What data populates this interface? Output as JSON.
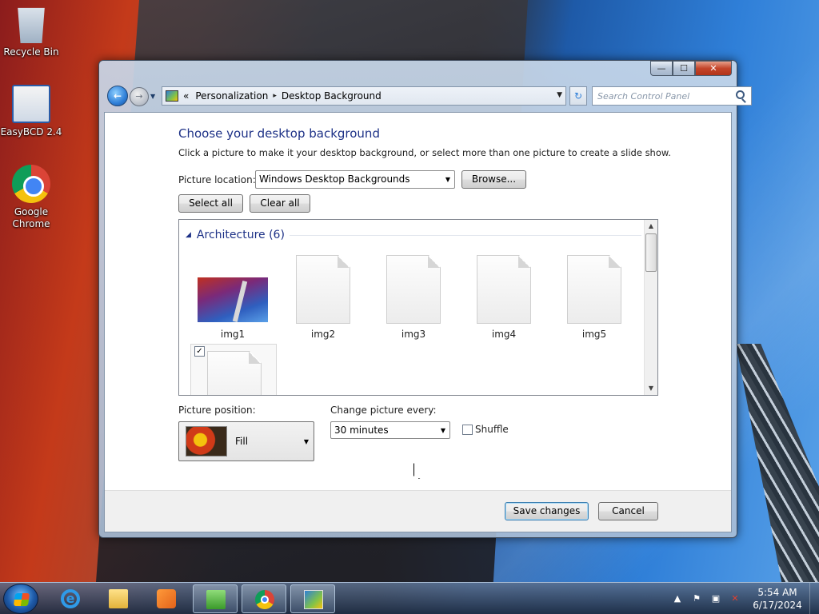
{
  "desktop": {
    "icons": [
      {
        "label": "Recycle Bin"
      },
      {
        "label": "EasyBCD 2.4"
      },
      {
        "label": "Google Chrome"
      }
    ]
  },
  "window": {
    "caption": {
      "minimize": "—",
      "maximize": "☐",
      "close": "✕"
    },
    "nav": {
      "back": "←",
      "forward": "→",
      "history": "▼"
    },
    "address": {
      "overflow": "«",
      "separator": "▸",
      "crumbs": [
        "Personalization",
        "Desktop Background"
      ],
      "dropdown": "▼"
    },
    "refresh": "↻",
    "search": {
      "placeholder": "Search Control Panel"
    }
  },
  "page": {
    "title": "Choose your desktop background",
    "instructions": "Click a picture to make it your desktop background, or select more than one picture to create a slide show.",
    "location": {
      "label": "Picture location:",
      "value": "Windows Desktop Backgrounds",
      "arrow": "▼"
    },
    "browse_label": "Browse...",
    "select_all_label": "Select all",
    "clear_all_label": "Clear all",
    "gallery": {
      "group_caret": "◢",
      "group_title": "Architecture (6)",
      "items": [
        {
          "label": "img1"
        },
        {
          "label": "img2"
        },
        {
          "label": "img3"
        },
        {
          "label": "img4"
        },
        {
          "label": "img5"
        }
      ],
      "sixth_checked_mark": "✓",
      "scroll_up": "▲",
      "scroll_down": "▼"
    },
    "position": {
      "label": "Picture position:",
      "value": "Fill",
      "arrow": "▼"
    },
    "interval": {
      "label": "Change picture every:",
      "value": "30 minutes",
      "arrow": "▼"
    },
    "shuffle_label": "Shuffle",
    "save_label": "Save changes",
    "cancel_label": "Cancel"
  },
  "taskbar": {
    "tray": {
      "chevron": "▲",
      "flag": "⚑",
      "network": "▣",
      "volume": "✕"
    },
    "clock": {
      "time": "5:54 AM",
      "date": "6/17/2024"
    }
  }
}
